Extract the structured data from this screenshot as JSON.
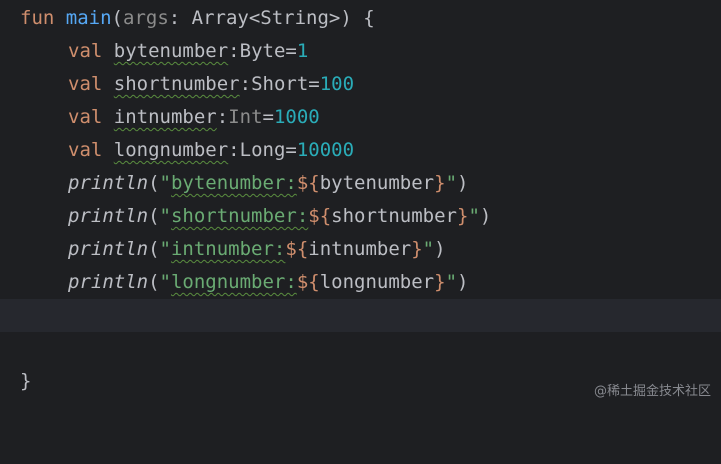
{
  "editor": {
    "lines": [
      {
        "keyword": "fun",
        "name": "main",
        "open": "(",
        "param": "args",
        "colon": ": ",
        "type": "Array<String>",
        "close": ") {"
      },
      {
        "keyword": "val",
        "name": "bytenumber",
        "colon": ":",
        "type": "Byte",
        "eq": "=",
        "value": "1"
      },
      {
        "keyword": "val",
        "name": "shortnumber",
        "colon": ":",
        "type": "Short",
        "eq": "=",
        "value": "100"
      },
      {
        "keyword": "val",
        "name": "intnumber",
        "colon": ":",
        "type": "Int",
        "eq": "=",
        "value": "1000"
      },
      {
        "keyword": "val",
        "name": "longnumber",
        "colon": ":",
        "type": "Long",
        "eq": "=",
        "value": "10000"
      },
      {
        "call": "println",
        "open": "(",
        "quote_open": "\"",
        "label": "bytenumber:",
        "tpl_open": "${",
        "var": "bytenumber",
        "tpl_close": "}",
        "quote_close": "\"",
        "close": ")"
      },
      {
        "call": "println",
        "open": "(",
        "quote_open": "\"",
        "label": "shortnumber:",
        "tpl_open": "${",
        "var": "shortnumber",
        "tpl_close": "}",
        "quote_close": "\"",
        "close": ")"
      },
      {
        "call": "println",
        "open": "(",
        "quote_open": "\"",
        "label": "intnumber:",
        "tpl_open": "${",
        "var": "intnumber",
        "tpl_close": "}",
        "quote_close": "\"",
        "close": ")"
      },
      {
        "call": "println",
        "open": "(",
        "quote_open": "\"",
        "label": "longnumber:",
        "tpl_open": "${",
        "var": "longnumber",
        "tpl_close": "}",
        "quote_close": "\"",
        "close": ")"
      },
      {
        "text": ""
      },
      {
        "text": ""
      },
      {
        "text": "}"
      }
    ]
  },
  "watermark": "@稀土掘金技术社区",
  "colors": {
    "background": "#1e1f22",
    "current_line": "#26282e",
    "keyword": "#cf8e6d",
    "function": "#56a8f5",
    "number": "#2aacb8",
    "string": "#6aab73"
  }
}
